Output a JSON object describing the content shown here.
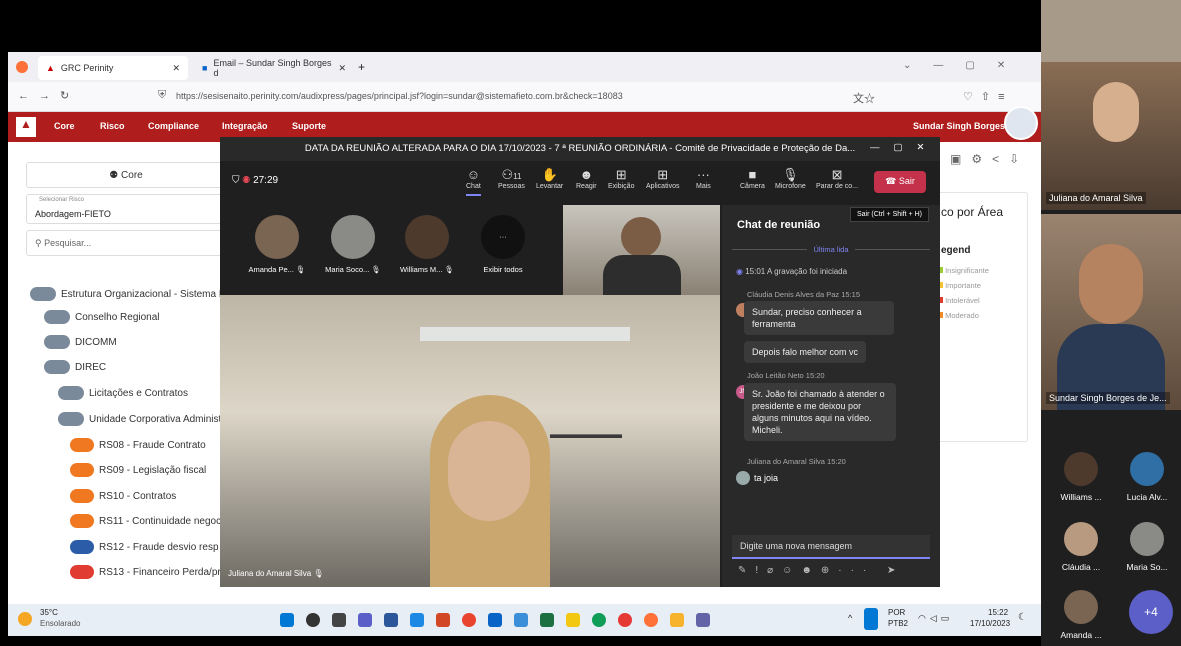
{
  "browser": {
    "tabs": [
      "GRC Perinity",
      "Email – Sundar Singh Borges d"
    ],
    "url": "https://sesisenaito.perinity.com/audixpress/pages/principal.jsf?login=sundar@sistemafieto.com.br&check=18083"
  },
  "appnav": {
    "items": [
      "Core",
      "Risco",
      "Compliance",
      "Integração",
      "Suporte"
    ],
    "user": "Sundar Singh Borges ..."
  },
  "left": {
    "core_label": "Core",
    "select_label": "Selecionar Risco",
    "select_value": "Abordagem-FIETO",
    "search_placeholder": "Pesquisar...",
    "tree": [
      "Estrutura Organizacional - Sistema F",
      "Conselho Regional",
      "DICOMM",
      "DIREC",
      "Licitações e Contratos",
      "Unidade Corporativa Administ",
      "RS08 - Fraude Contrato",
      "RS09 - Legislação fiscal",
      "RS10 - Contratos",
      "RS11 - Continuidade negoc",
      "RS12 - Fraude desvio resp",
      "RS13 - Financeiro Perda/pr"
    ]
  },
  "right_panel": {
    "title": "co por Área",
    "legend_title": "egend",
    "legend": [
      {
        "label": "Insignificante",
        "color": "#9acd32"
      },
      {
        "label": "Importante",
        "color": "#f4c430"
      },
      {
        "label": "Intolerável",
        "color": "#e03c31"
      },
      {
        "label": "Moderado",
        "color": "#f28c28"
      }
    ]
  },
  "teams": {
    "title": "DATA DA REUNIÃO ALTERADA PARA O DIA 17/10/2023 - 7 ª REUNIÃO ORDINÁRIA - Comitê de Privacidade e Proteção de Da...",
    "timer": "27:29",
    "people_count": "11",
    "toolbar": [
      "Chat",
      "Pessoas",
      "Levantar",
      "Reagir",
      "Exibição",
      "Aplicativos",
      "Mais",
      "Câmera",
      "Microfone",
      "Parar de co..."
    ],
    "leave": "Sair",
    "tooltip": "Sair (Ctrl + Shift + H)",
    "participants": [
      "Amanda Pe...",
      "Maria Soco...",
      "Williams M...",
      "Exibir todos"
    ],
    "main_speaker": "Juliana do Amaral Silva",
    "chat": {
      "title": "Chat de reunião",
      "last_read": "Última lida",
      "system_time": "15:01",
      "system_msg": "A gravação foi iniciada",
      "m1_author": "Cláudia Denis Alves da Paz  15:15",
      "m1_text": "Sundar, preciso conhecer a ferramenta",
      "m2_text": "Depois falo melhor com vc",
      "m3_author": "João Leitão Neto  15:20",
      "m3_text": "Sr. João foi chamado à atender o presidente e me deixou por alguns minutos aqui na vídeo. Micheli.",
      "m4_author": "Juliana do Amaral Silva  15:20",
      "m4_text": "ta joia",
      "compose_placeholder": "Digite uma nova mensagem"
    }
  },
  "strip": {
    "tiles": [
      "Juliana do Amaral Silva",
      "Sundar Singh Borges de Je..."
    ],
    "small": [
      "Williams ...",
      "Lucia Alv...",
      "Cláudia ...",
      "Maria So...",
      "Amanda ..."
    ],
    "more": "+4"
  },
  "taskbar": {
    "temp": "35°C",
    "weather": "Ensolarado",
    "lang1": "POR",
    "lang2": "PTB2",
    "time": "15:22",
    "date": "17/10/2023"
  }
}
